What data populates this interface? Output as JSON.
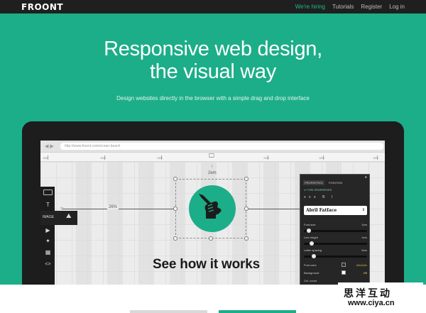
{
  "header": {
    "logo": "FROONT",
    "nav": [
      "We're hiring",
      "Tutorials",
      "Register",
      "Log in"
    ]
  },
  "hero": {
    "title_line1": "Responsive web design,",
    "title_line2": "the visual way",
    "subtitle": "Design websites directly in the browser with a simple drag and drop interface"
  },
  "browser": {
    "url": "http://www.froont.com/ocean-beach",
    "back": "◀",
    "forward": "▶"
  },
  "ruler_labels": [
    "1500",
    "1500",
    "1500",
    "1500",
    "1500",
    "1500"
  ],
  "canvas": {
    "dim_top": "2em",
    "dim_left": "26%",
    "tool_image_label": "IMAGE",
    "how": "See how it works"
  },
  "panel": {
    "tab1": "PROPERTIES",
    "tab2": "POSITION",
    "type_section": "∨ TYPE PROPERTIES",
    "align_glyphs": "≡≡≡ B I",
    "font": "Abril Fatface",
    "rows": [
      {
        "label": "Font-size",
        "value": "1em"
      },
      {
        "label": "Line-height",
        "value": "1em"
      },
      {
        "label": "Letter spacing",
        "value": "0em"
      },
      {
        "label": "Font color",
        "value": "#2c2c2c"
      },
      {
        "label": "Background",
        "value": "#fff"
      },
      {
        "label": "Col. count",
        "value": ""
      }
    ]
  },
  "watermark": {
    "line1": "思洋互动",
    "line2": "www.ciya.cn"
  },
  "colors": {
    "accent": "#1cae88",
    "dark": "#1f1f1f",
    "highlight_nav": "#1fba8e"
  }
}
